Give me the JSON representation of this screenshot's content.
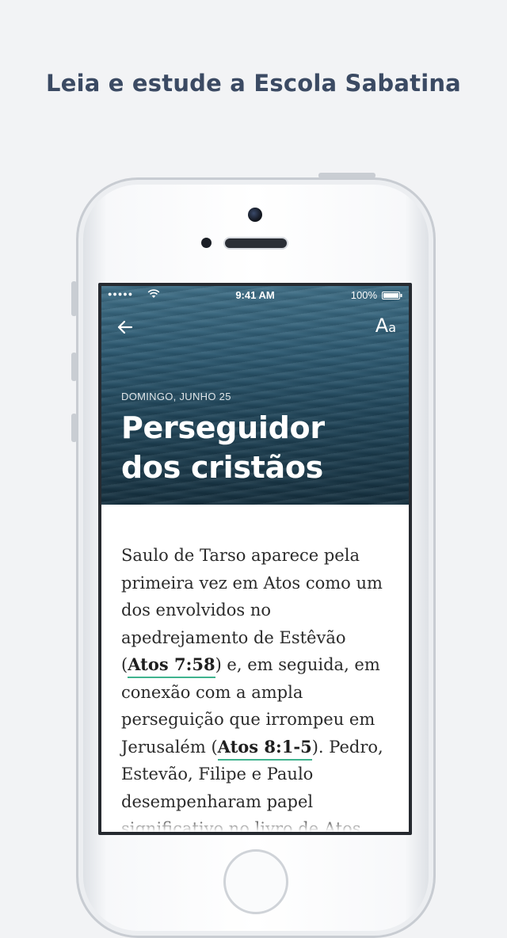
{
  "headline": "Leia e estude a Escola Sabatina",
  "status_bar": {
    "signal": "●●●●●",
    "time": "9:41 AM",
    "battery": "100%"
  },
  "toolbar": {
    "back_icon": "arrow-left-icon",
    "font_settings_label_large": "A",
    "font_settings_label_small": "a"
  },
  "lesson": {
    "date": "DOMINGO, JUNHO 25",
    "title": "Perseguidor dos cristãos"
  },
  "article": {
    "text_1": "Saulo de Tarso aparece pela primeira vez em Atos como um dos envolvidos no apedrejamento de Estêvão (",
    "verse_1": "Atos 7:58",
    "text_2": ") e, em seguida, em conexão com a ampla perseguição que irrompeu em Jerusalém (",
    "verse_2": "Atos 8:1-5",
    "text_3": "). Pedro, Estevão, Filipe e Paulo desempenharam papel significativo no livro de Atos"
  },
  "colors": {
    "background": "#f2f3f5",
    "headline": "#3b4a63",
    "link_underline": "#3fb38e"
  }
}
